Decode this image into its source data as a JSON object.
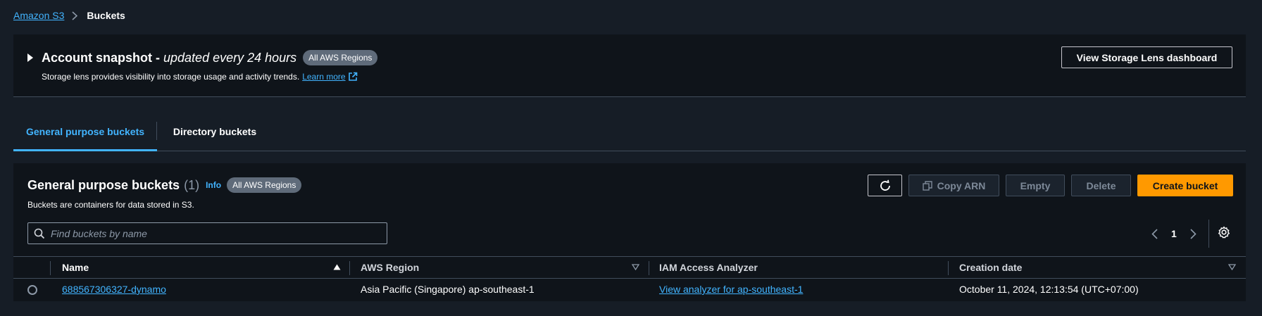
{
  "breadcrumb": {
    "root": "Amazon S3",
    "current": "Buckets"
  },
  "snapshot": {
    "title": "Account snapshot -",
    "title_italic": "updated every 24 hours",
    "region_badge": "All AWS Regions",
    "description": "Storage lens provides visibility into storage usage and activity trends.",
    "learn_more": "Learn more",
    "lens_button": "View Storage Lens dashboard"
  },
  "tabs": [
    {
      "label": "General purpose buckets",
      "active": true
    },
    {
      "label": "Directory buckets",
      "active": false
    }
  ],
  "panel": {
    "title": "General purpose buckets",
    "count": "(1)",
    "info": "Info",
    "region_badge": "All AWS Regions",
    "subtitle": "Buckets are containers for data stored in S3.",
    "buttons": {
      "copy_arn": "Copy ARN",
      "empty": "Empty",
      "delete": "Delete",
      "create": "Create bucket"
    },
    "search_placeholder": "Find buckets by name",
    "page": "1"
  },
  "table": {
    "columns": [
      "Name",
      "AWS Region",
      "IAM Access Analyzer",
      "Creation date"
    ],
    "rows": [
      {
        "name": "688567306327-dynamo",
        "region": "Asia Pacific (Singapore) ap-southeast-1",
        "iam": "View analyzer for ap-southeast-1",
        "created": "October 11, 2024, 12:13:54 (UTC+07:00)"
      }
    ]
  },
  "colors": {
    "background": "#161d26",
    "panel": "#0f141a",
    "link": "#42b4ff",
    "primary_button": "#ff9900",
    "badge": "#5f6b7a"
  },
  "icons": {
    "breadcrumb_separator": "chevron-right-icon",
    "snapshot_expander": "caret-right-icon",
    "external_link": "external-link-icon",
    "refresh": "refresh-icon",
    "copy": "copy-icon",
    "search": "search-icon",
    "pagination_prev": "chevron-left-icon",
    "pagination_next": "chevron-right-icon",
    "settings": "gear-icon",
    "sort_ascending": "sort-ascending-icon",
    "sort_descending": "sort-descending-icon"
  }
}
